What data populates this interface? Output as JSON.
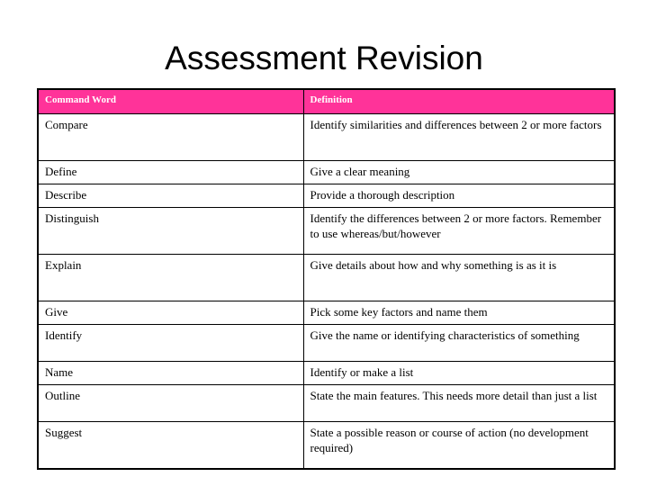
{
  "slide": {
    "title": "Assessment Revision"
  },
  "colors": {
    "header_background": "#ff3399",
    "header_text": "#ffffff",
    "border": "#000000",
    "body_text": "#000000",
    "page_background": "#ffffff"
  },
  "table": {
    "headers": {
      "command_word": "Command Word",
      "definition": "Definition"
    },
    "rows": [
      {
        "command_word": "Compare",
        "definition": "Identify similarities and differences between 2 or more factors"
      },
      {
        "command_word": "Define",
        "definition": "Give a clear meaning"
      },
      {
        "command_word": "Describe",
        "definition": "Provide a thorough description"
      },
      {
        "command_word": "Distinguish",
        "definition": "Identify the differences between 2 or more factors. Remember to use whereas/but/however"
      },
      {
        "command_word": "Explain",
        "definition": "Give details about how and why something is as it is"
      },
      {
        "command_word": "Give",
        "definition": "Pick some key factors and name them"
      },
      {
        "command_word": "Identify",
        "definition": "Give the name or identifying characteristics of something"
      },
      {
        "command_word": "Name",
        "definition": "Identify or make a list"
      },
      {
        "command_word": "Outline",
        "definition": "State the main features.  This needs more detail than just a list"
      },
      {
        "command_word": "Suggest",
        "definition": "State a possible reason or course of action (no development required)"
      }
    ]
  }
}
